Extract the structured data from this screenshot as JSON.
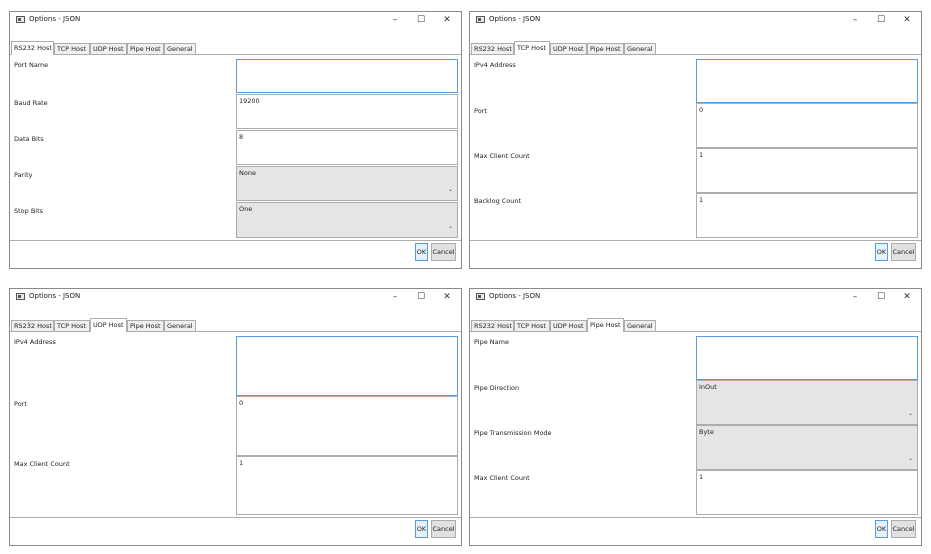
{
  "window_title": "Options - JSON",
  "window_controls": {
    "minimize": "–",
    "maximize": "☐",
    "close": "✕"
  },
  "tabs": [
    "RS232 Host",
    "TCP Host",
    "UDP Host",
    "Pipe Host",
    "General"
  ],
  "buttons": {
    "ok": "OK",
    "cancel": "Cancel"
  },
  "rs232": {
    "port_name_label": "Port Name",
    "port_name_value": "",
    "baud_rate_label": "Baud Rate",
    "baud_rate_value": "19200",
    "data_bits_label": "Data Bits",
    "data_bits_value": "8",
    "parity_label": "Parity",
    "parity_value": "None",
    "stop_bits_label": "Stop Bits",
    "stop_bits_value": "One"
  },
  "tcp": {
    "ipv4_label": "IPv4 Address",
    "ipv4_value": "",
    "port_label": "Port",
    "port_value": "0",
    "max_client_label": "Max Client Count",
    "max_client_value": "1",
    "backlog_label": "Backlog Count",
    "backlog_value": "1"
  },
  "udp": {
    "ipv4_label": "IPv4 Address",
    "ipv4_value": "",
    "port_label": "Port",
    "port_value": "0",
    "max_client_label": "Max Client Count",
    "max_client_value": "1"
  },
  "pipe": {
    "name_label": "Pipe Name",
    "name_value": "",
    "direction_label": "Pipe Direction",
    "direction_value": "InOut",
    "mode_label": "Pipe Transmission Mode",
    "mode_value": "Byte",
    "max_client_label": "Max Client Count",
    "max_client_value": "1"
  },
  "colors": {
    "focus_border": "#569de5",
    "combo_bg": "#e5e5e5",
    "button_bg": "#e1e1e1"
  }
}
